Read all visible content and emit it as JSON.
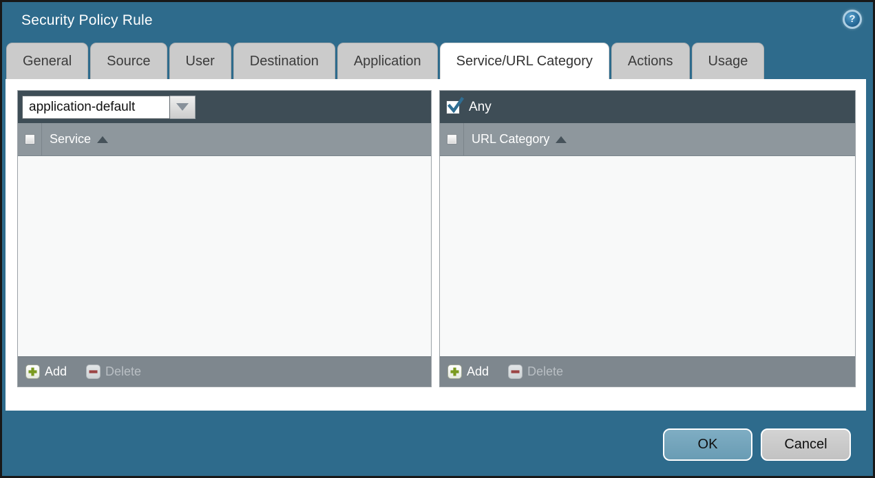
{
  "dialog": {
    "title": "Security Policy Rule",
    "help_glyph": "?"
  },
  "tabs": [
    {
      "label": "General"
    },
    {
      "label": "Source"
    },
    {
      "label": "User"
    },
    {
      "label": "Destination"
    },
    {
      "label": "Application"
    },
    {
      "label": "Service/URL Category",
      "active": true
    },
    {
      "label": "Actions"
    },
    {
      "label": "Usage"
    }
  ],
  "service_panel": {
    "dropdown_value": "application-default",
    "column_header": "Service",
    "sort_direction": "ascending",
    "rows": [],
    "add_label": "Add",
    "delete_label": "Delete",
    "delete_enabled": false
  },
  "url_category_panel": {
    "any_label": "Any",
    "any_checked": true,
    "column_header": "URL Category",
    "sort_direction": "ascending",
    "rows": [],
    "add_label": "Add",
    "delete_label": "Delete",
    "delete_enabled": false
  },
  "footer": {
    "ok_label": "OK",
    "cancel_label": "Cancel"
  },
  "colors": {
    "dialog_teal": "#2e6b8c",
    "panel_topbar": "#3e4d56",
    "panel_header": "#8e979d",
    "panel_footer": "#7e878e",
    "tab_gray": "#cbcbcb",
    "add_green": "#7a9a1f",
    "delete_red": "#9b4444",
    "check_blue": "#2f6e93",
    "ok_blue": "#73a5bd"
  }
}
